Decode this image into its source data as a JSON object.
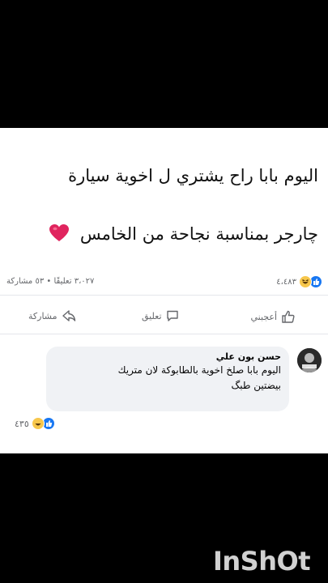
{
  "post": {
    "line1": "اليوم بابا راح يشتري ل اخوية سيارة",
    "line2": "چارجر  بمناسبة نجاحة من الخامس",
    "reactions_count": "٤،٤٨٣",
    "comments_shares": "٣،٠٢٧ تعليقًا • ٥٣ مشاركة"
  },
  "actions": {
    "like": "أعجبني",
    "comment": "تعليق",
    "share": "مشاركة"
  },
  "comment": {
    "author": "حسن بون علي",
    "text_line1": "اليوم بابا صلخ اخوية بالطابوكة  لان متريك",
    "text_line2": "بيضتين طبگ",
    "reactions_count": "٤٣٥"
  },
  "watermark": "InShOt",
  "colors": {
    "facebook_blue": "#1877f2",
    "heart_red": "#e0245e",
    "haha_yellow": "#f7c74c"
  }
}
